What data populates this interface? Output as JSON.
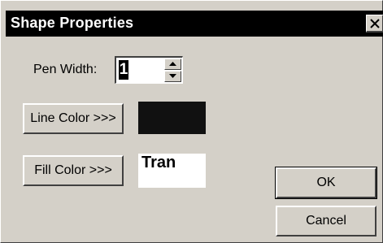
{
  "window": {
    "title": "Shape Properties"
  },
  "pen_width": {
    "label": "Pen Width:",
    "value": "1"
  },
  "line_color": {
    "button_label": "Line Color >>>",
    "swatch_color": "#111111"
  },
  "fill_color": {
    "button_label": "Fill Color >>>",
    "swatch_text": "Tran",
    "swatch_color": "#ffffff"
  },
  "buttons": {
    "ok": "OK",
    "cancel": "Cancel"
  },
  "colors": {
    "face": "#d4d0c8",
    "titlebar": "#000000"
  },
  "icons": {
    "close": "close-icon",
    "spin_up": "spin-up-arrow-icon",
    "spin_down": "spin-down-arrow-icon"
  }
}
